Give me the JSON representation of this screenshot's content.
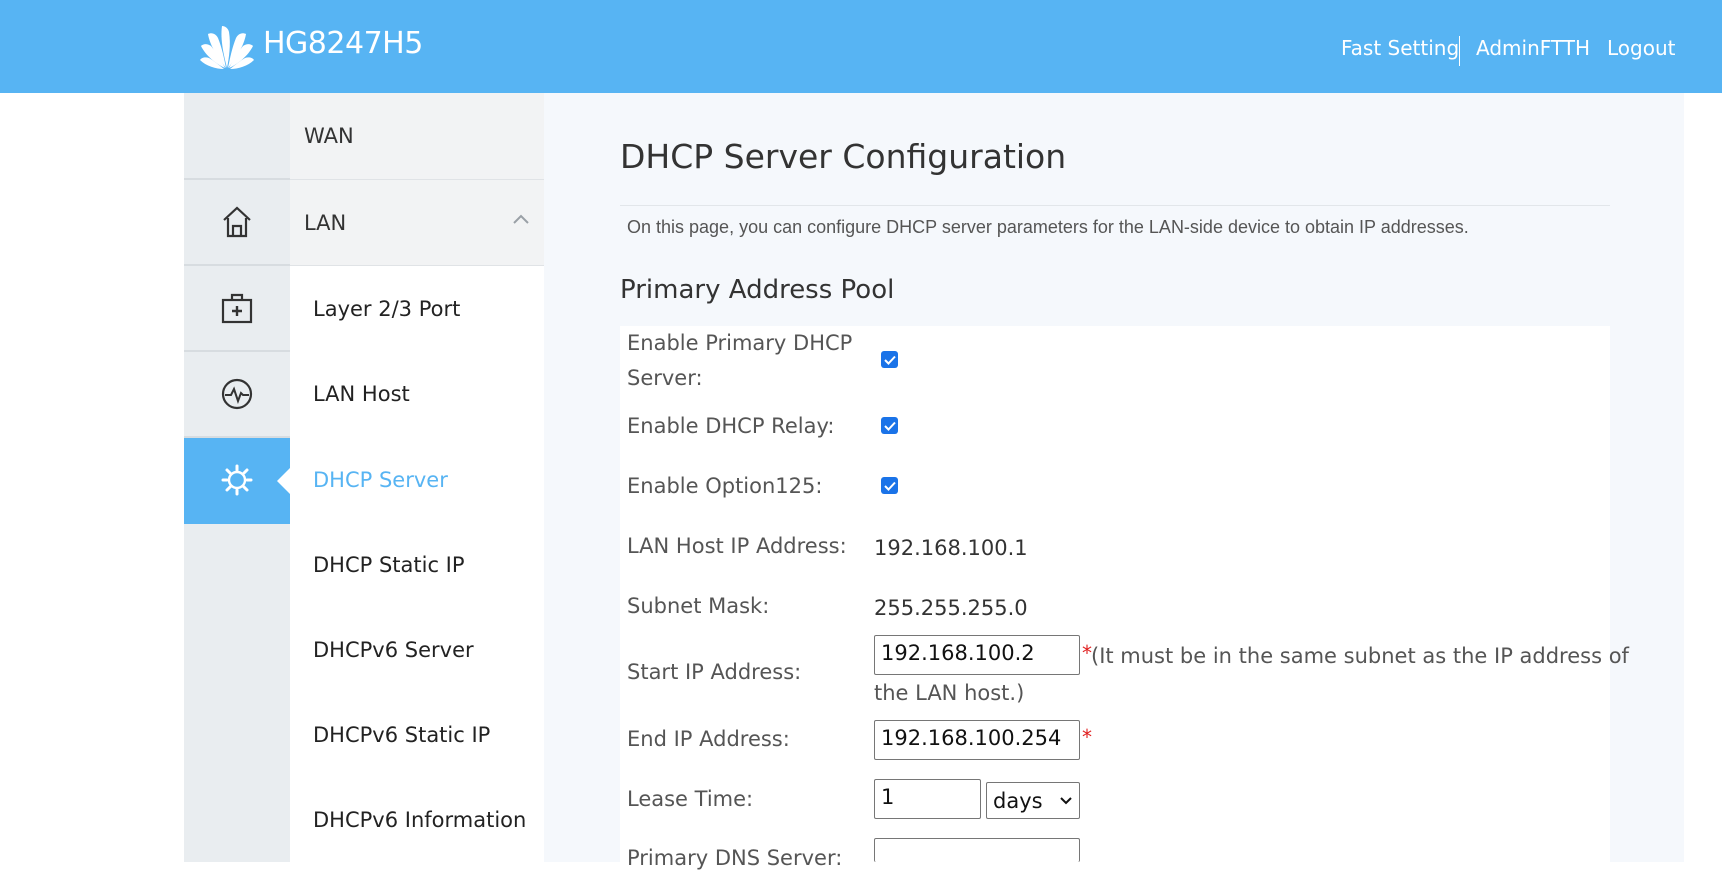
{
  "header": {
    "model": "HG8247H5",
    "links": {
      "fast_setting": "Fast Setting",
      "user": "AdminFTTH",
      "logout": "Logout"
    },
    "color": "#57b4f3"
  },
  "icons": [
    "home-icon",
    "medical-kit-icon",
    "diagnosis-icon",
    "gear-icon"
  ],
  "submenu": {
    "wan": "WAN",
    "lan": "LAN",
    "items": [
      "Layer 2/3 Port",
      "LAN Host",
      "DHCP Server",
      "DHCP Static IP",
      "DHCPv6 Server",
      "DHCPv6 Static IP",
      "DHCPv6 Information"
    ],
    "active": "DHCP Server"
  },
  "main": {
    "title": "DHCP Server Configuration",
    "description": "On this page, you can configure DHCP server parameters for the LAN-side device to obtain IP addresses.",
    "section": "Primary Address Pool",
    "fields": {
      "enable_primary_line1": "Enable Primary DHCP",
      "enable_primary_line2": "Server:",
      "enable_relay": "Enable DHCP Relay:",
      "enable_option125": "Enable Option125:",
      "lan_host_ip_label": "LAN Host IP Address:",
      "lan_host_ip_value": "192.168.100.1",
      "subnet_mask_label": "Subnet Mask:",
      "subnet_mask_value": "255.255.255.0",
      "start_ip_label": "Start IP Address:",
      "start_ip_value": "192.168.100.2",
      "start_ip_hint_line1": "(It must be in the same subnet as the IP address of",
      "start_ip_hint_line2": "the LAN host.)",
      "end_ip_label": "End IP Address:",
      "end_ip_value": "192.168.100.254",
      "lease_time_label": "Lease Time:",
      "lease_time_value": "1",
      "lease_unit": "days",
      "primary_dns_label": "Primary DNS Server:",
      "primary_dns_value": "",
      "required_mark": "*"
    },
    "checkboxes": {
      "enable_primary": true,
      "enable_relay": true,
      "enable_option125": true
    }
  }
}
